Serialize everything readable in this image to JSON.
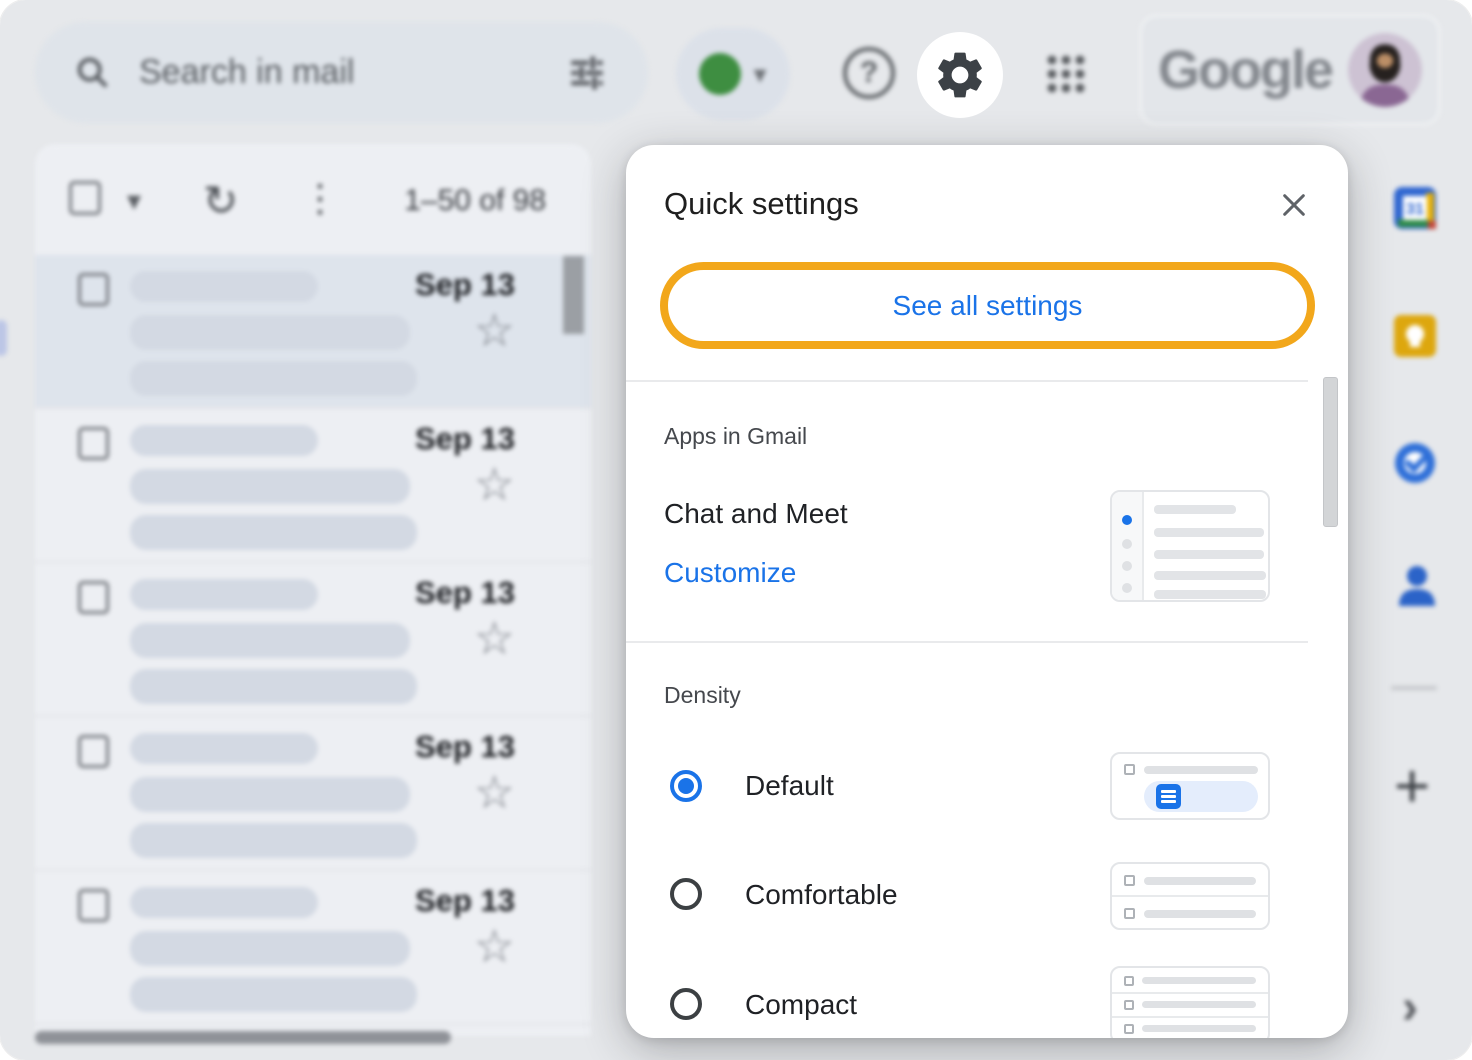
{
  "topbar": {
    "search": {
      "placeholder": "Search in mail"
    },
    "google_wordmark": "Google"
  },
  "toolbar": {
    "range_label": "1–50 of 98"
  },
  "email_rows": [
    {
      "date": "Sep 13",
      "selected": true
    },
    {
      "date": "Sep 13",
      "selected": false
    },
    {
      "date": "Sep 13",
      "selected": false
    },
    {
      "date": "Sep 13",
      "selected": false
    },
    {
      "date": "Sep 13",
      "selected": false
    }
  ],
  "quick_settings": {
    "title": "Quick settings",
    "see_all_label": "See all settings",
    "apps_section": {
      "heading": "Apps in Gmail",
      "item_label": "Chat and Meet",
      "link_label": "Customize"
    },
    "density_section": {
      "heading": "Density",
      "options": [
        {
          "label": "Default",
          "selected": true
        },
        {
          "label": "Comfortable",
          "selected": false
        },
        {
          "label": "Compact",
          "selected": false
        }
      ]
    }
  },
  "icons": {
    "caret_down": "▾",
    "refresh": "↻",
    "more_vertical": "⋮",
    "star": "☆",
    "help": "?",
    "plus": "+",
    "chevron_right": "›"
  },
  "colors": {
    "accent_blue": "#1a73e8",
    "highlight_ring": "#F2A71B",
    "status_green": "#3e8e41"
  }
}
